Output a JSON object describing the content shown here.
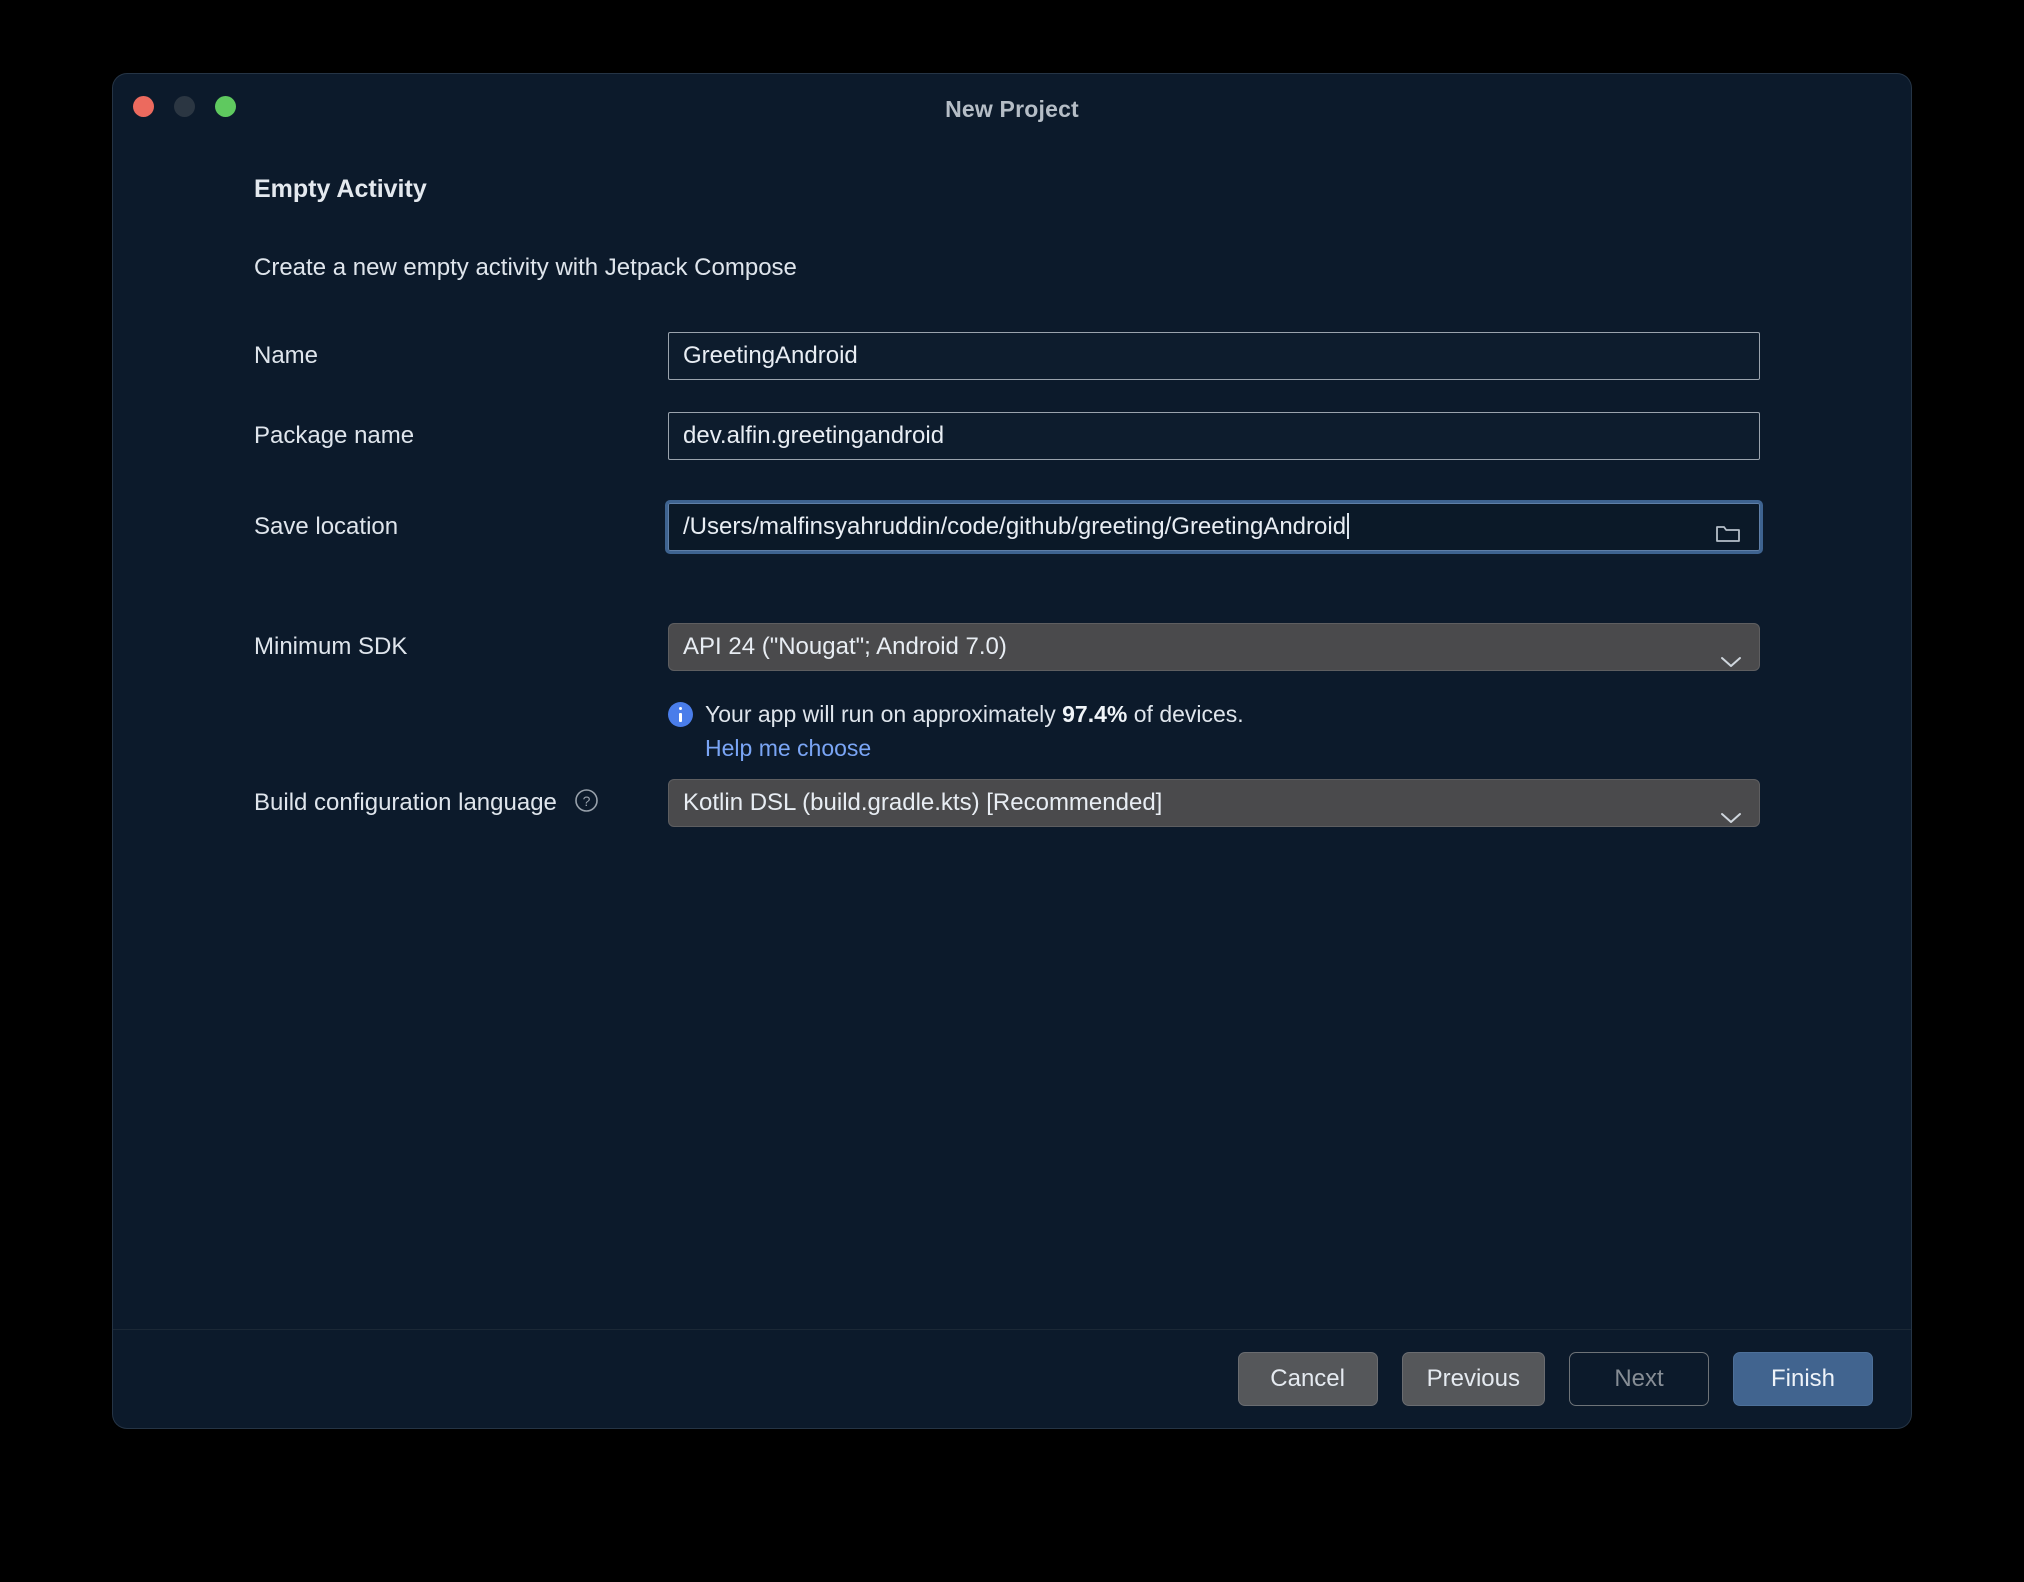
{
  "window": {
    "title": "New Project",
    "traffic_lights": [
      {
        "name": "close",
        "color": "#ec6a5e"
      },
      {
        "name": "minimize",
        "color": "#2b3642"
      },
      {
        "name": "zoom",
        "color": "#5fc95f"
      }
    ]
  },
  "wizard": {
    "heading": "Empty Activity",
    "subheading": "Create a new empty activity with Jetpack Compose"
  },
  "fields": {
    "name": {
      "label": "Name",
      "value": "GreetingAndroid"
    },
    "package_name": {
      "label": "Package name",
      "value": "dev.alfin.greetingandroid"
    },
    "save_location": {
      "label": "Save location",
      "value": "/Users/malfinsyahruddin/code/github/greeting/GreetingAndroid",
      "browse_icon": "folder-icon",
      "focused": true
    },
    "minimum_sdk": {
      "label": "Minimum SDK",
      "value": "API 24 (\"Nougat\"; Android 7.0)",
      "chevron": "chevron-down-icon"
    },
    "build_configuration_language": {
      "label": "Build configuration language",
      "help_icon": "question-mark-icon",
      "value": "Kotlin DSL (build.gradle.kts) [Recommended]",
      "chevron": "chevron-down-icon"
    }
  },
  "sdk_info": {
    "icon": "info-icon",
    "text_before": "Your app will run on approximately",
    "percent": "97.4%",
    "text_after": "of devices.",
    "help_link": "Help me choose"
  },
  "footer": {
    "buttons": [
      {
        "label": "Cancel",
        "style": "grey",
        "enabled": true
      },
      {
        "label": "Previous",
        "style": "grey",
        "enabled": true
      },
      {
        "label": "Next",
        "style": "ghost",
        "enabled": false
      },
      {
        "label": "Finish",
        "style": "accent",
        "enabled": true
      }
    ]
  },
  "colors": {
    "dialog_background": "#0c1a2b",
    "accent_button": "#41648f",
    "link": "#7aa5f5",
    "info_icon": "#4a7dea",
    "focus_ring": "#3e6390"
  }
}
